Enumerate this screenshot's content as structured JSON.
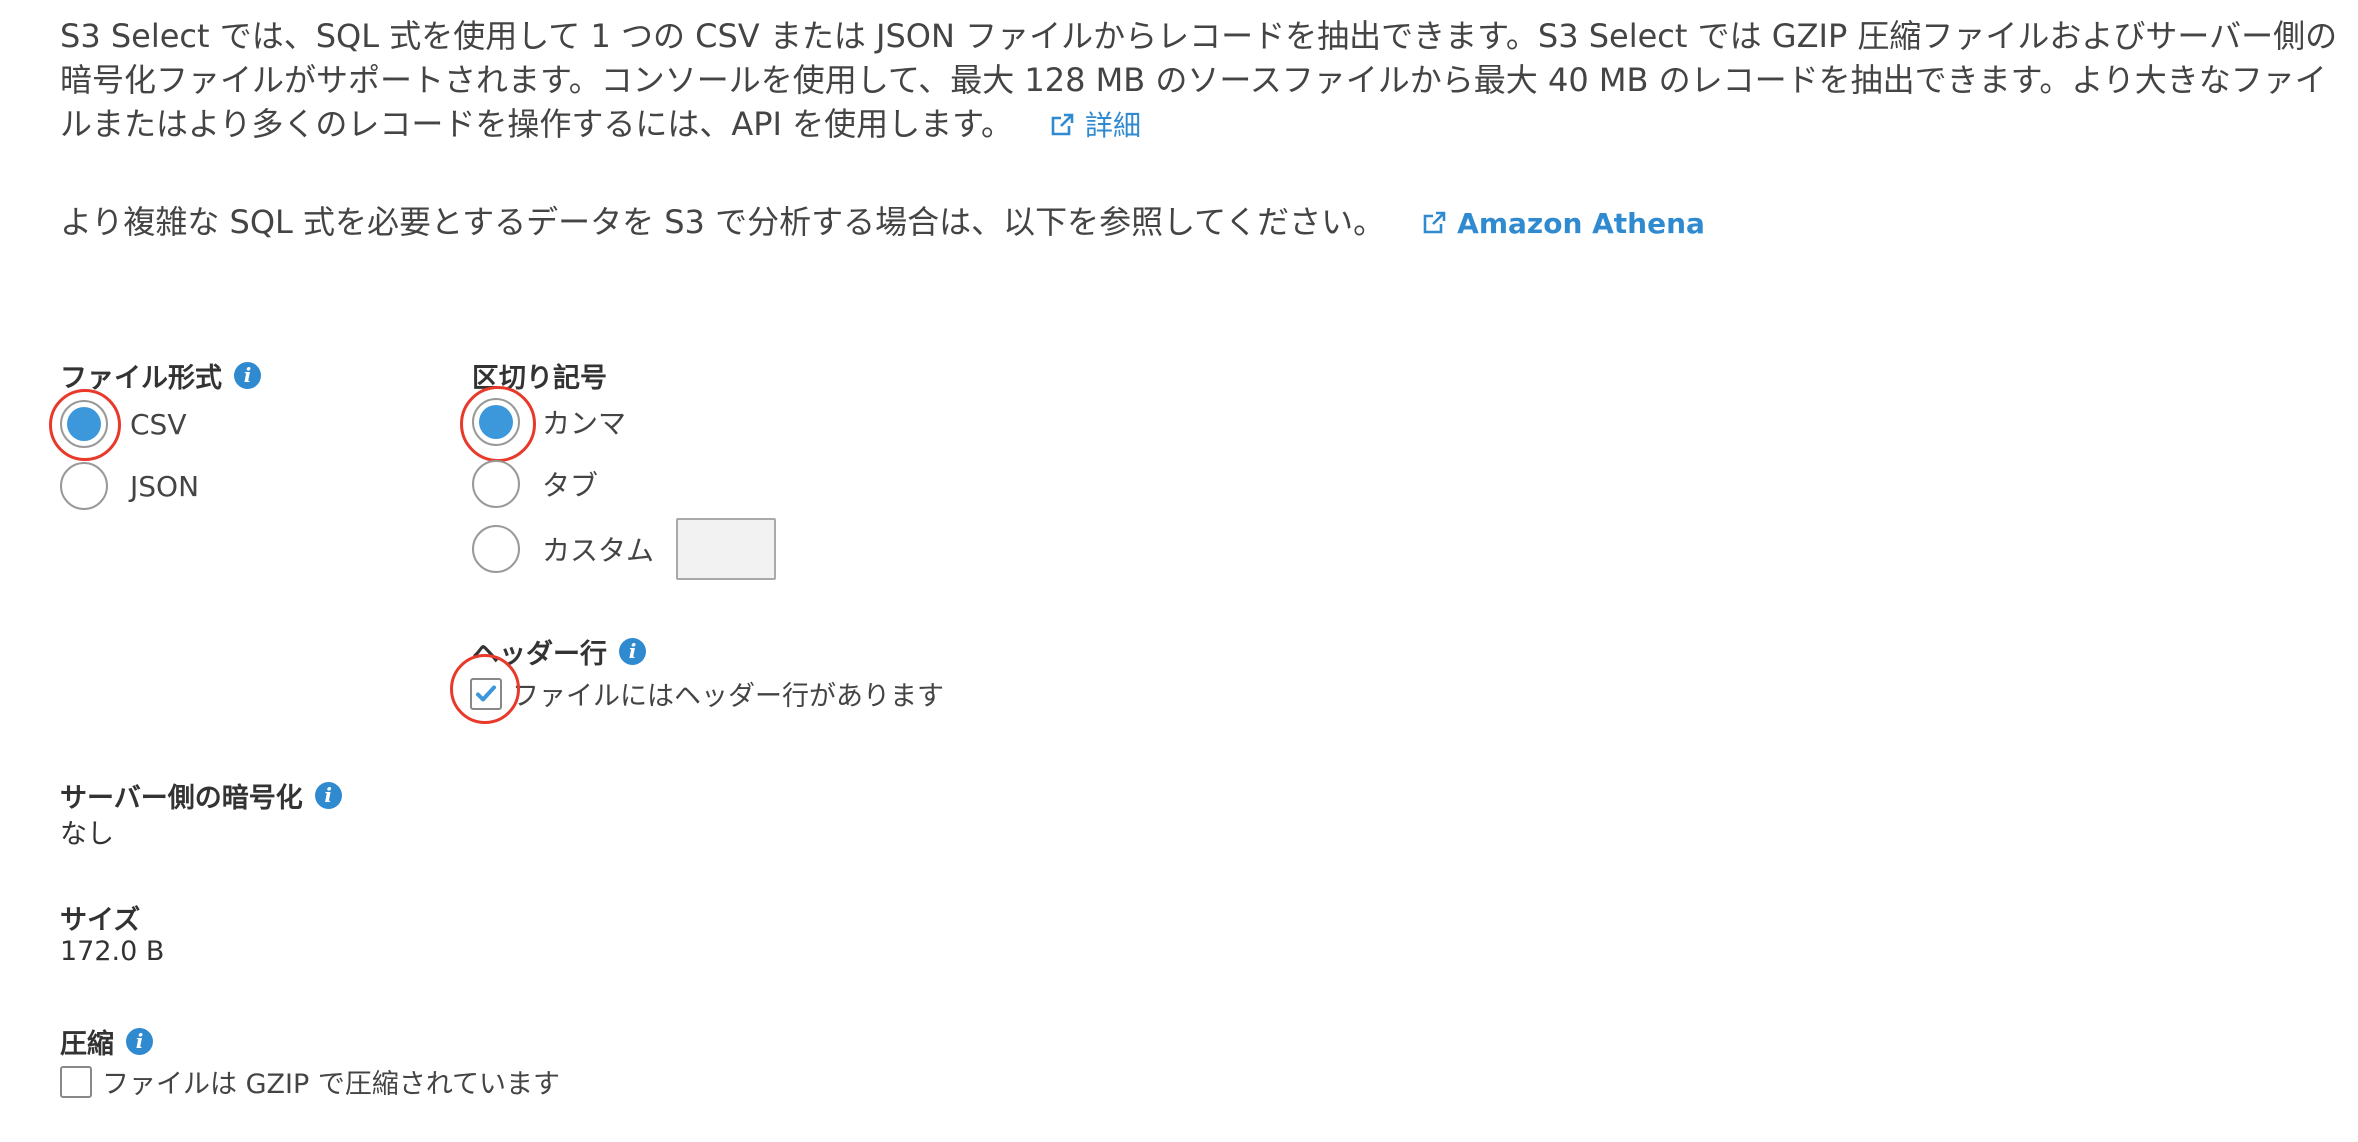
{
  "intro": {
    "paragraph1": "S3 Select では、SQL 式を使用して 1 つの CSV または JSON ファイルからレコードを抽出できます。S3 Select では GZIP 圧縮ファイルおよびサーバー側の暗号化ファイルがサポートされます。コンソールを使用して、最大 128 MB のソースファイルから最大 40 MB のレコードを抽出できます。より大きなファイルまたはより多くのレコードを操作するには、API を使用します。",
    "details_link": "詳細",
    "paragraph2": "より複雑な SQL 式を必要とするデータを S3 で分析する場合は、以下を参照してください。",
    "athena_link": "Amazon Athena"
  },
  "file_format": {
    "label": "ファイル形式",
    "info_icon": "info-icon",
    "options": [
      {
        "label": "CSV",
        "selected": true
      },
      {
        "label": "JSON",
        "selected": false
      }
    ]
  },
  "delimiter": {
    "label": "区切り記号",
    "options": [
      {
        "label": "カンマ",
        "selected": true
      },
      {
        "label": "タブ",
        "selected": false
      },
      {
        "label": "カスタム",
        "selected": false
      }
    ],
    "custom_value": ""
  },
  "header_row": {
    "label": "ヘッダー行",
    "info_icon": "info-icon",
    "checkbox_label": "ファイルにはヘッダー行があります",
    "checked": true
  },
  "server_side_encryption": {
    "label": "サーバー側の暗号化",
    "info_icon": "info-icon",
    "value": "なし"
  },
  "size": {
    "label": "サイズ",
    "value": "172.0 B"
  },
  "compression": {
    "label": "圧縮",
    "info_icon": "info-icon",
    "checkbox_label": "ファイルは GZIP で圧縮されています",
    "checked": false
  },
  "colors": {
    "accent": "#3d98db",
    "link": "#2f8ad0",
    "highlight": "#e8392b"
  }
}
